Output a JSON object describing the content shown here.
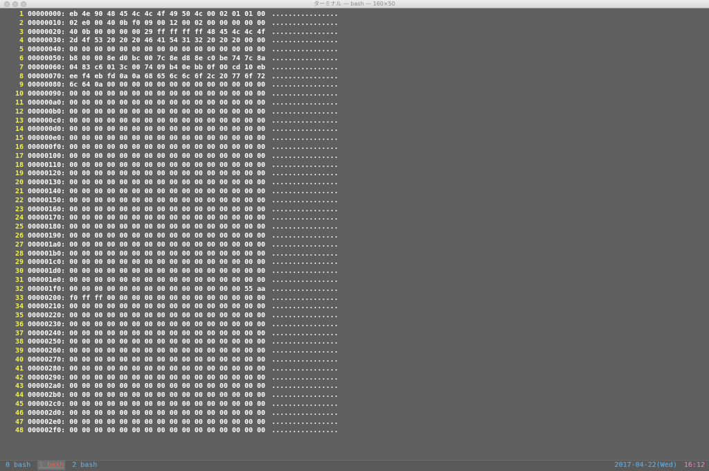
{
  "window": {
    "title": "ターミナル — bash — 160×50"
  },
  "hexdump": {
    "rows": [
      {
        "n": "1",
        "addr": "00000000:",
        "hex": "eb 4e 90 48 45 4c 4c 4f 49 50 4c 00 02 01 01 00",
        "ascii": "................"
      },
      {
        "n": "2",
        "addr": "00000010:",
        "hex": "02 e0 00 40 0b f0 09 00 12 00 02 00 00 00 00 00",
        "ascii": "................"
      },
      {
        "n": "3",
        "addr": "00000020:",
        "hex": "40 0b 00 00 00 00 29 ff ff ff ff 48 45 4c 4c 4f",
        "ascii": "................"
      },
      {
        "n": "4",
        "addr": "00000030:",
        "hex": "2d 4f 53 20 20 20 46 41 54 31 32 20 20 20 00 00",
        "ascii": "................"
      },
      {
        "n": "5",
        "addr": "00000040:",
        "hex": "00 00 00 00 00 00 00 00 00 00 00 00 00 00 00 00",
        "ascii": "................"
      },
      {
        "n": "6",
        "addr": "00000050:",
        "hex": "b8 00 00 8e d0 bc 00 7c 8e d8 8e c0 be 74 7c 8a",
        "ascii": "................"
      },
      {
        "n": "7",
        "addr": "00000060:",
        "hex": "04 83 c6 01 3c 00 74 09 b4 0e bb 0f 00 cd 10 eb",
        "ascii": "................"
      },
      {
        "n": "8",
        "addr": "00000070:",
        "hex": "ee f4 eb fd 0a 0a 68 65 6c 6c 6f 2c 20 77 6f 72",
        "ascii": "................"
      },
      {
        "n": "9",
        "addr": "00000080:",
        "hex": "6c 64 0a 00 00 00 00 00 00 00 00 00 00 00 00 00",
        "ascii": "................"
      },
      {
        "n": "10",
        "addr": "00000090:",
        "hex": "00 00 00 00 00 00 00 00 00 00 00 00 00 00 00 00",
        "ascii": "................"
      },
      {
        "n": "11",
        "addr": "000000a0:",
        "hex": "00 00 00 00 00 00 00 00 00 00 00 00 00 00 00 00",
        "ascii": "................"
      },
      {
        "n": "12",
        "addr": "000000b0:",
        "hex": "00 00 00 00 00 00 00 00 00 00 00 00 00 00 00 00",
        "ascii": "................"
      },
      {
        "n": "13",
        "addr": "000000c0:",
        "hex": "00 00 00 00 00 00 00 00 00 00 00 00 00 00 00 00",
        "ascii": "................"
      },
      {
        "n": "14",
        "addr": "000000d0:",
        "hex": "00 00 00 00 00 00 00 00 00 00 00 00 00 00 00 00",
        "ascii": "................"
      },
      {
        "n": "15",
        "addr": "000000e0:",
        "hex": "00 00 00 00 00 00 00 00 00 00 00 00 00 00 00 00",
        "ascii": "................"
      },
      {
        "n": "16",
        "addr": "000000f0:",
        "hex": "00 00 00 00 00 00 00 00 00 00 00 00 00 00 00 00",
        "ascii": "................"
      },
      {
        "n": "17",
        "addr": "00000100:",
        "hex": "00 00 00 00 00 00 00 00 00 00 00 00 00 00 00 00",
        "ascii": "................"
      },
      {
        "n": "18",
        "addr": "00000110:",
        "hex": "00 00 00 00 00 00 00 00 00 00 00 00 00 00 00 00",
        "ascii": "................"
      },
      {
        "n": "19",
        "addr": "00000120:",
        "hex": "00 00 00 00 00 00 00 00 00 00 00 00 00 00 00 00",
        "ascii": "................"
      },
      {
        "n": "20",
        "addr": "00000130:",
        "hex": "00 00 00 00 00 00 00 00 00 00 00 00 00 00 00 00",
        "ascii": "................"
      },
      {
        "n": "21",
        "addr": "00000140:",
        "hex": "00 00 00 00 00 00 00 00 00 00 00 00 00 00 00 00",
        "ascii": "................"
      },
      {
        "n": "22",
        "addr": "00000150:",
        "hex": "00 00 00 00 00 00 00 00 00 00 00 00 00 00 00 00",
        "ascii": "................"
      },
      {
        "n": "23",
        "addr": "00000160:",
        "hex": "00 00 00 00 00 00 00 00 00 00 00 00 00 00 00 00",
        "ascii": "................"
      },
      {
        "n": "24",
        "addr": "00000170:",
        "hex": "00 00 00 00 00 00 00 00 00 00 00 00 00 00 00 00",
        "ascii": "................"
      },
      {
        "n": "25",
        "addr": "00000180:",
        "hex": "00 00 00 00 00 00 00 00 00 00 00 00 00 00 00 00",
        "ascii": "................"
      },
      {
        "n": "26",
        "addr": "00000190:",
        "hex": "00 00 00 00 00 00 00 00 00 00 00 00 00 00 00 00",
        "ascii": "................"
      },
      {
        "n": "27",
        "addr": "000001a0:",
        "hex": "00 00 00 00 00 00 00 00 00 00 00 00 00 00 00 00",
        "ascii": "................"
      },
      {
        "n": "28",
        "addr": "000001b0:",
        "hex": "00 00 00 00 00 00 00 00 00 00 00 00 00 00 00 00",
        "ascii": "................"
      },
      {
        "n": "29",
        "addr": "000001c0:",
        "hex": "00 00 00 00 00 00 00 00 00 00 00 00 00 00 00 00",
        "ascii": "................"
      },
      {
        "n": "30",
        "addr": "000001d0:",
        "hex": "00 00 00 00 00 00 00 00 00 00 00 00 00 00 00 00",
        "ascii": "................"
      },
      {
        "n": "31",
        "addr": "000001e0:",
        "hex": "00 00 00 00 00 00 00 00 00 00 00 00 00 00 00 00",
        "ascii": "................"
      },
      {
        "n": "32",
        "addr": "000001f0:",
        "hex": "00 00 00 00 00 00 00 00 00 00 00 00 00 00 55 aa",
        "ascii": "................"
      },
      {
        "n": "33",
        "addr": "00000200:",
        "hex": "f0 ff ff 00 00 00 00 00 00 00 00 00 00 00 00 00",
        "ascii": "................"
      },
      {
        "n": "34",
        "addr": "00000210:",
        "hex": "00 00 00 00 00 00 00 00 00 00 00 00 00 00 00 00",
        "ascii": "................"
      },
      {
        "n": "35",
        "addr": "00000220:",
        "hex": "00 00 00 00 00 00 00 00 00 00 00 00 00 00 00 00",
        "ascii": "................"
      },
      {
        "n": "36",
        "addr": "00000230:",
        "hex": "00 00 00 00 00 00 00 00 00 00 00 00 00 00 00 00",
        "ascii": "................"
      },
      {
        "n": "37",
        "addr": "00000240:",
        "hex": "00 00 00 00 00 00 00 00 00 00 00 00 00 00 00 00",
        "ascii": "................"
      },
      {
        "n": "38",
        "addr": "00000250:",
        "hex": "00 00 00 00 00 00 00 00 00 00 00 00 00 00 00 00",
        "ascii": "................"
      },
      {
        "n": "39",
        "addr": "00000260:",
        "hex": "00 00 00 00 00 00 00 00 00 00 00 00 00 00 00 00",
        "ascii": "................"
      },
      {
        "n": "40",
        "addr": "00000270:",
        "hex": "00 00 00 00 00 00 00 00 00 00 00 00 00 00 00 00",
        "ascii": "................"
      },
      {
        "n": "41",
        "addr": "00000280:",
        "hex": "00 00 00 00 00 00 00 00 00 00 00 00 00 00 00 00",
        "ascii": "................"
      },
      {
        "n": "42",
        "addr": "00000290:",
        "hex": "00 00 00 00 00 00 00 00 00 00 00 00 00 00 00 00",
        "ascii": "................"
      },
      {
        "n": "43",
        "addr": "000002a0:",
        "hex": "00 00 00 00 00 00 00 00 00 00 00 00 00 00 00 00",
        "ascii": "................"
      },
      {
        "n": "44",
        "addr": "000002b0:",
        "hex": "00 00 00 00 00 00 00 00 00 00 00 00 00 00 00 00",
        "ascii": "................"
      },
      {
        "n": "45",
        "addr": "000002c0:",
        "hex": "00 00 00 00 00 00 00 00 00 00 00 00 00 00 00 00",
        "ascii": "................"
      },
      {
        "n": "46",
        "addr": "000002d0:",
        "hex": "00 00 00 00 00 00 00 00 00 00 00 00 00 00 00 00",
        "ascii": "................"
      },
      {
        "n": "47",
        "addr": "000002e0:",
        "hex": "00 00 00 00 00 00 00 00 00 00 00 00 00 00 00 00",
        "ascii": "................"
      },
      {
        "n": "48",
        "addr": "000002f0:",
        "hex": "00 00 00 00 00 00 00 00 00 00 00 00 00 00 00 00",
        "ascii": "................"
      }
    ]
  },
  "statusbar": {
    "tabs": [
      {
        "label": "0 bash",
        "active": false
      },
      {
        "label": "1 bash",
        "active": true
      },
      {
        "label": "2 bash",
        "active": false
      }
    ],
    "date": "2017-04-22(Wed)",
    "time": "16:12"
  },
  "colors": {
    "background": "#5f5f5f",
    "line_number": "#f2f250",
    "text": "#ffffff",
    "tab": "#5fb7f0",
    "active_tab": "#ff5f40",
    "time": "#ff7fd0"
  }
}
